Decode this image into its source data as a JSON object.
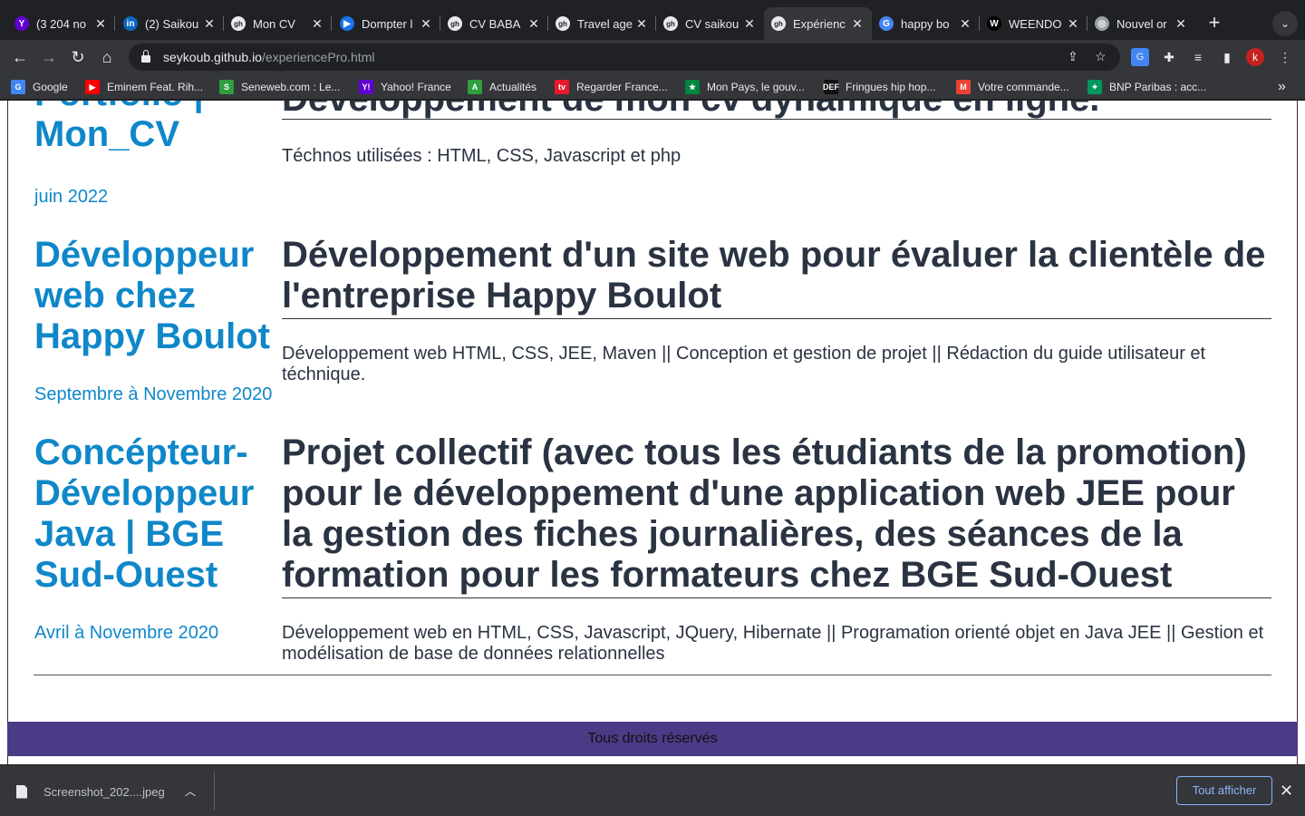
{
  "tabs": [
    {
      "title": "(3 204 no",
      "favicon": "Y",
      "color": "#6001d2"
    },
    {
      "title": "(2) Saikou",
      "favicon": "in",
      "color": "#0a66c2"
    },
    {
      "title": "Mon CV",
      "favicon": "gh",
      "color": "#ffffff"
    },
    {
      "title": "Dompter l",
      "favicon": "▶",
      "color": "#1a73e8"
    },
    {
      "title": "CV BABA",
      "favicon": "gh",
      "color": "#ffffff"
    },
    {
      "title": "Travel age",
      "favicon": "gh",
      "color": "#ffffff"
    },
    {
      "title": "CV saikou",
      "favicon": "gh",
      "color": "#ffffff"
    },
    {
      "title": "Expérienc",
      "favicon": "gh",
      "color": "#ffffff"
    },
    {
      "title": "happy bo",
      "favicon": "G",
      "color": "#4285f4"
    },
    {
      "title": "WEENDO",
      "favicon": "W",
      "color": "#000000"
    },
    {
      "title": "Nouvel or",
      "favicon": "◎",
      "color": "#9aa0a6"
    }
  ],
  "active_tab_index": 7,
  "address": {
    "domain": "seykoub.github.io",
    "path": "/experiencePro.html"
  },
  "bookmarks": [
    {
      "label": "Google",
      "favicon": "G",
      "color": "#4285f4"
    },
    {
      "label": "Eminem Feat. Rih...",
      "favicon": "▶",
      "color": "#ff0000"
    },
    {
      "label": "Seneweb.com : Le...",
      "favicon": "S",
      "color": "#2e9e3f"
    },
    {
      "label": "Yahoo! France",
      "favicon": "Y!",
      "color": "#6001d2"
    },
    {
      "label": "Actualités",
      "favicon": "A",
      "color": "#2e9e3f"
    },
    {
      "label": "Regarder France...",
      "favicon": "tv",
      "color": "#e8192c"
    },
    {
      "label": "Mon Pays, le gouv...",
      "favicon": "★",
      "color": "#00853f"
    },
    {
      "label": "Fringues hip hop...",
      "favicon": "DEF",
      "color": "#111111"
    },
    {
      "label": "Votre commande...",
      "favicon": "M",
      "color": "#ea4335"
    },
    {
      "label": "BNP Paribas : acc...",
      "favicon": "✦",
      "color": "#00965e"
    }
  ],
  "bookmarks_more": "»",
  "page": {
    "top_job_title": "Portfolio | Mon_CV",
    "top_job_title_line1": "Portfolio |",
    "top_job_title_line2": "Mon_CV",
    "top_project_title": "Développement de mon cv dynamique en ligne.",
    "top_project_desc": "Téchnos utilisées : HTML, CSS, Javascript et php",
    "top_job_date": "juin 2022",
    "experiences": [
      {
        "job_title": "Développeur web chez Happy Boulot",
        "job_date": "Septembre à Novembre 2020",
        "project_title": "Développement d'un site web pour évaluer la clientèle de l'entreprise Happy Boulot",
        "project_desc": "Développement web HTML, CSS, JEE, Maven || Conception et gestion de projet || Rédaction du guide utilisateur et téchnique."
      },
      {
        "job_title": "Concépteur-Développeur Java | BGE Sud-Ouest",
        "job_date": "Avril à Novembre 2020",
        "project_title": "Projet collectif (avec tous les étudiants de la promotion) pour le développement d'une application web JEE pour la gestion des fiches journalières, des séances de la formation pour les formateurs chez BGE Sud-Ouest",
        "project_desc": "Développement web en HTML, CSS, Javascript, JQuery, Hibernate || Programation orienté objet en Java JEE || Gestion et modélisation de base de données relationnelles"
      }
    ],
    "footer": "Tous droits réservés"
  },
  "downloads": {
    "file_name": "Screenshot_202....jpeg",
    "show_all": "Tout afficher"
  },
  "profile_initial": "k",
  "colors": {
    "accent_blue": "#0f87c9",
    "heading_dark": "#2a3342",
    "footer_purple": "#4b3b86"
  }
}
